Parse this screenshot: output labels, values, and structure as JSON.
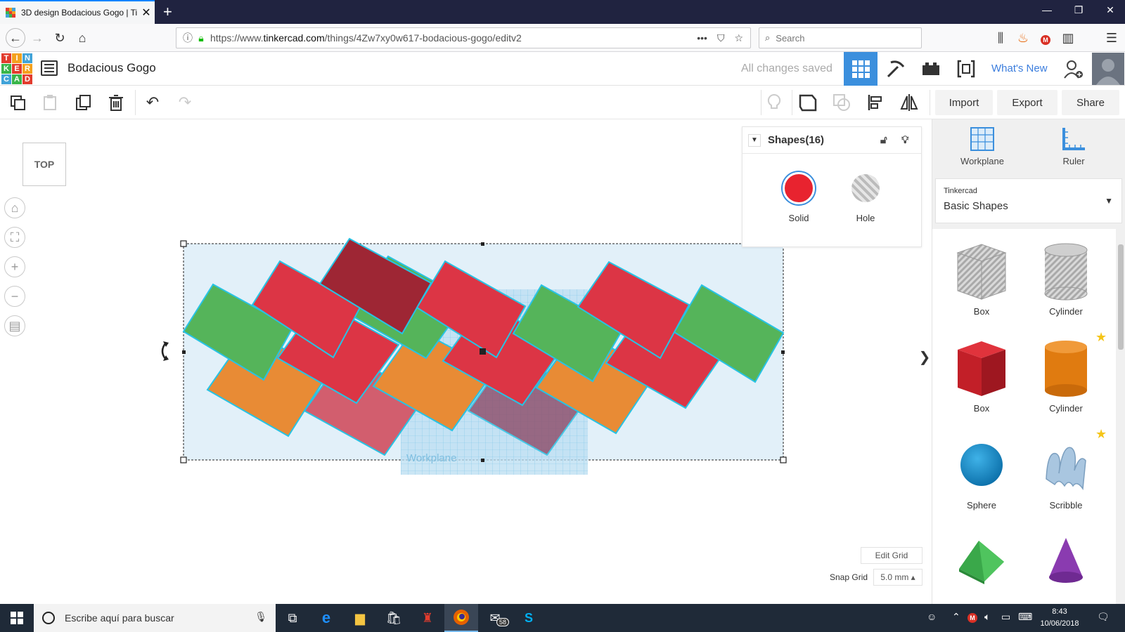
{
  "browser": {
    "tab_title": "3D design Bodacious Gogo | Ti",
    "tab_close": "✕",
    "new_tab": "+",
    "url_prefix": "https://www.",
    "url_domain": "tinkercad.com",
    "url_path": "/things/4Zw7xy0w617-bodacious-gogo/editv2",
    "search_placeholder": "Search"
  },
  "app": {
    "logo": [
      "T",
      "I",
      "N",
      "K",
      "E",
      "R",
      "C",
      "A",
      "D"
    ],
    "logo_colors": [
      "#e23c2e",
      "#f4a11e",
      "#41a3d8",
      "#3ab54a",
      "#e23c2e",
      "#f4a11e",
      "#41a3d8",
      "#3ab54a",
      "#e23c2e"
    ],
    "design_title": "Bodacious Gogo",
    "save_status": "All changes saved",
    "whats_new": "What's New"
  },
  "toolbar": {
    "import": "Import",
    "export": "Export",
    "share": "Share"
  },
  "canvas": {
    "view_cube": "TOP",
    "workplane_label": "Workplane",
    "edit_grid": "Edit Grid",
    "snap_grid_label": "Snap Grid",
    "snap_grid_value": "5.0 mm ▴"
  },
  "inspector": {
    "title": "Shapes(16)",
    "solid_label": "Solid",
    "hole_label": "Hole",
    "solid_color": "#e8232f"
  },
  "right_panel": {
    "workplane": "Workplane",
    "ruler": "Ruler",
    "library_vendor": "Tinkercad",
    "library_name": "Basic Shapes",
    "shapes": [
      {
        "label": "Box"
      },
      {
        "label": "Cylinder"
      },
      {
        "label": "Box"
      },
      {
        "label": "Cylinder"
      },
      {
        "label": "Sphere"
      },
      {
        "label": "Scribble"
      }
    ]
  },
  "taskbar": {
    "search_placeholder": "Escribe aquí para buscar",
    "badge_count": "58",
    "time": "8:43",
    "date": "10/06/2018"
  },
  "colors": {
    "green": "#55b45a",
    "red": "#dc3545",
    "dark_red": "#9e2634",
    "orange": "#e88b35",
    "pink": "#d25e6e",
    "plum": "#8c4a68",
    "selection_fill": "#e2f0f9",
    "outline": "#27c3e4"
  }
}
